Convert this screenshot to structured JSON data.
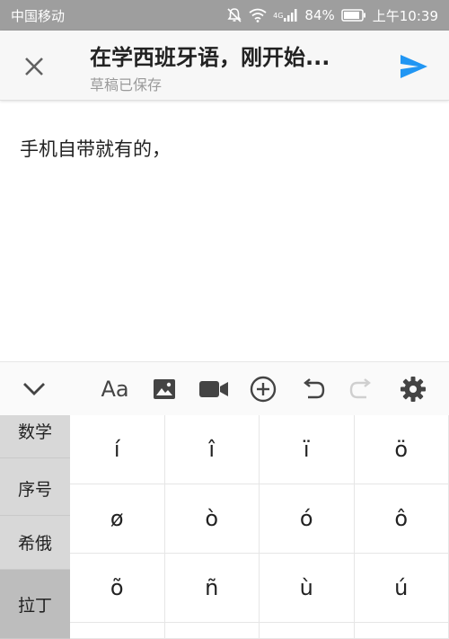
{
  "status_bar": {
    "carrier": "中国移动",
    "network_label": "4G",
    "battery": "84%",
    "time": "上午10:39"
  },
  "header": {
    "title": "在学西班牙语，刚开始...",
    "subtitle": "草稿已保存"
  },
  "body": {
    "text": "手机自带就有的，"
  },
  "toolbar": {
    "icons": [
      "chevron-down-icon",
      "text-format-icon",
      "image-icon",
      "video-icon",
      "add-circle-icon",
      "undo-icon",
      "redo-icon",
      "settings-icon"
    ],
    "font_label": "Aa"
  },
  "keyboard": {
    "categories": [
      "数学",
      "序号",
      "希俄",
      "拉丁"
    ],
    "active_category": "拉丁",
    "rows": [
      [
        "í",
        "î",
        "ï",
        "ö"
      ],
      [
        "ø",
        "ò",
        "ó",
        "ô"
      ],
      [
        "õ",
        "ñ",
        "ù",
        "ú"
      ]
    ]
  },
  "colors": {
    "accent": "#2196f3",
    "status_bar_bg": "#9e9e9e",
    "sidebar_bg": "#d8d8d8",
    "sidebar_active": "#bdbdbd"
  }
}
